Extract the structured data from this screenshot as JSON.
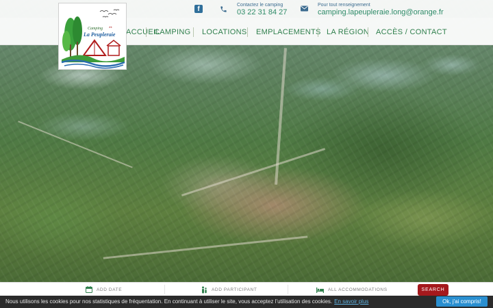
{
  "site": {
    "logo_text_line1": "Camping",
    "logo_text_line2": "La Peupleraie",
    "logo_stars": "**"
  },
  "contact": {
    "phone_label": "Contactez le camping",
    "phone_value": "03 22 31 84 27",
    "email_label": "Pour tout renseignement",
    "email_value": "camping.lapeupleraie.long@orange.fr",
    "facebook_icon": "facebook-icon",
    "phone_icon": "phone-icon",
    "mail_icon": "mail-icon"
  },
  "nav": {
    "items": [
      {
        "label": "ACCUEIL"
      },
      {
        "label": "CAMPING"
      },
      {
        "label": "LOCATIONS"
      },
      {
        "label": "EMPLACEMENTS"
      },
      {
        "label": "LA RÉGION"
      },
      {
        "label": "ACCÈS / CONTACT"
      }
    ]
  },
  "booking": {
    "date_label": "ADD DATE",
    "participant_label": "ADD PARTICIPANT",
    "accommodation_label": "ALL ACCOMMODATIONS",
    "search_label": "SEARCH"
  },
  "cookie": {
    "message": "Nous utilisons les cookies pour nos statistiques de fréquentation. En continuant à utiliser le site, vous acceptez l’utilisation des cookies.",
    "link_text": "En savoir plus",
    "accept_label": "Ok, j'ai compris!"
  },
  "colors": {
    "nav_text": "#2f7f4c",
    "contact_value": "#2e8b68",
    "search_button": "#a5191d",
    "cookie_button": "#2a8fd0"
  }
}
